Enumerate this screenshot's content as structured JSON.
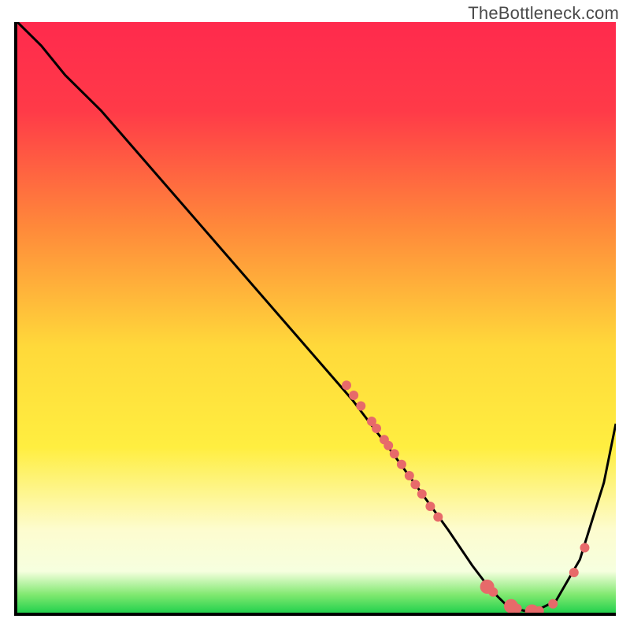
{
  "attribution": "TheBottleneck.com",
  "chart_data": {
    "type": "line",
    "title": "",
    "xlabel": "",
    "ylabel": "",
    "xlim": [
      0,
      100
    ],
    "ylim": [
      0,
      100
    ],
    "gradient_bands": [
      {
        "stop": 0.0,
        "name": "red",
        "color": "#ff2a4d"
      },
      {
        "stop": 0.15,
        "name": "red",
        "color": "#ff3a48"
      },
      {
        "stop": 0.35,
        "name": "orange",
        "color": "#ff8a3a"
      },
      {
        "stop": 0.55,
        "name": "yellow",
        "color": "#ffd93a"
      },
      {
        "stop": 0.72,
        "name": "yellow",
        "color": "#ffee40"
      },
      {
        "stop": 0.86,
        "name": "pale",
        "color": "#fdfccf"
      },
      {
        "stop": 0.93,
        "name": "cream",
        "color": "#f6ffdf"
      },
      {
        "stop": 0.97,
        "name": "green",
        "color": "#7fe86f"
      },
      {
        "stop": 1.0,
        "name": "green",
        "color": "#24d14e"
      }
    ],
    "series": [
      {
        "name": "bottleneck-curve",
        "x": [
          0,
          4,
          8,
          14,
          20,
          26,
          32,
          38,
          44,
          50,
          56,
          62,
          67,
          72,
          76,
          79,
          82,
          86,
          90,
          94,
          98,
          100
        ],
        "y": [
          100,
          96,
          91,
          85,
          78,
          71,
          64,
          57,
          50,
          43,
          36,
          28,
          21,
          14,
          8,
          4,
          1,
          0,
          2,
          9,
          22,
          32
        ]
      }
    ],
    "markers": {
      "name": "highlight-dots",
      "color": "#e76a6a",
      "radius_small": 6,
      "radius_large": 9,
      "points": [
        {
          "x": 55.0,
          "y": 38.5,
          "r": 6
        },
        {
          "x": 56.2,
          "y": 36.8,
          "r": 6
        },
        {
          "x": 57.4,
          "y": 35.0,
          "r": 6
        },
        {
          "x": 59.2,
          "y": 32.4,
          "r": 6
        },
        {
          "x": 60.0,
          "y": 31.2,
          "r": 6
        },
        {
          "x": 61.3,
          "y": 29.3,
          "r": 6
        },
        {
          "x": 62.0,
          "y": 28.3,
          "r": 6
        },
        {
          "x": 63.0,
          "y": 26.9,
          "r": 6
        },
        {
          "x": 64.2,
          "y": 25.1,
          "r": 6
        },
        {
          "x": 65.5,
          "y": 23.2,
          "r": 6
        },
        {
          "x": 66.5,
          "y": 21.7,
          "r": 6
        },
        {
          "x": 67.6,
          "y": 20.1,
          "r": 6
        },
        {
          "x": 69.0,
          "y": 18.0,
          "r": 6
        },
        {
          "x": 70.3,
          "y": 16.2,
          "r": 6
        },
        {
          "x": 78.5,
          "y": 4.4,
          "r": 9
        },
        {
          "x": 79.5,
          "y": 3.5,
          "r": 6
        },
        {
          "x": 82.5,
          "y": 1.1,
          "r": 9
        },
        {
          "x": 83.5,
          "y": 0.7,
          "r": 6
        },
        {
          "x": 86.0,
          "y": 0.2,
          "r": 9
        },
        {
          "x": 87.2,
          "y": 0.3,
          "r": 6
        },
        {
          "x": 89.5,
          "y": 1.5,
          "r": 6
        },
        {
          "x": 93.0,
          "y": 6.8,
          "r": 6
        },
        {
          "x": 94.8,
          "y": 11.0,
          "r": 6
        }
      ]
    }
  }
}
